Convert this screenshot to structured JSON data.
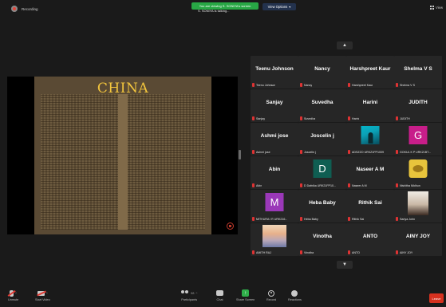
{
  "topbar": {
    "recording_label": "Recording",
    "share_banner": "You are viewing S. SONIYA's screen",
    "share_sub": "S. SONIYA is talking...",
    "view_options": "View Options",
    "view_options_caret": "▾",
    "view_label": "View"
  },
  "shared_screen": {
    "slide_title": "CHINA"
  },
  "gallery": {
    "scroll_up_icon": "▲",
    "scroll_down_icon": "▼",
    "tiles": [
      {
        "name": "Teenu Johnson",
        "label": "Teenu Johnson"
      },
      {
        "name": "Nancy",
        "label": "Nancy"
      },
      {
        "name": "Harshpreet Kaur",
        "label": "Harshpreet Kaur"
      },
      {
        "name": "Shelma V S",
        "label": "Shelma V S"
      },
      {
        "name": "Sanjay",
        "label": "Sanjay"
      },
      {
        "name": "Suvedha",
        "label": "Suvedha"
      },
      {
        "name": "Harini",
        "label": "Harini"
      },
      {
        "name": "JUDITH",
        "label": "JUDITH"
      },
      {
        "name": "Ashmi jose",
        "label": "Ashmi jose"
      },
      {
        "name": "Joscelin j",
        "label": "Joscelin j"
      },
      {
        "name": "",
        "label": "ADSZZO URKZ1FP1009"
      },
      {
        "name": "",
        "label": "GOKUL K P URK21BT..."
      },
      {
        "name": "Abin",
        "label": "Abin"
      },
      {
        "name": "",
        "label": "D Dafnika URK21FP10..."
      },
      {
        "name": "Naseer A M",
        "label": "Naseer A M"
      },
      {
        "name": "",
        "label": "Nishitha Midhun"
      },
      {
        "name": "",
        "label": "MITHURA I R URK216..."
      },
      {
        "name": "Heba Baby",
        "label": "Heba Baby"
      },
      {
        "name": "Rithik Sai",
        "label": "Rithik Sai"
      },
      {
        "name": "",
        "label": "Sariya John"
      },
      {
        "name": "",
        "label": "AMITH RAJ"
      },
      {
        "name": "Vinotha",
        "label": "Vinotha"
      },
      {
        "name": "ANTO",
        "label": "ANTO"
      },
      {
        "name": "AINY JOY",
        "label": "AINY JOY"
      }
    ],
    "avatars": {
      "tile11": "",
      "tile12": "G",
      "tile14": "D",
      "tile17": "M"
    }
  },
  "toolbar": {
    "unmute": "Unmute",
    "start_video": "Start Video",
    "participants": "Participants",
    "participants_count": "98",
    "chat": "Chat",
    "share_screen": "Share Screen",
    "record": "Record",
    "reactions": "Reactions",
    "leave": "Leave",
    "caret": "^"
  }
}
